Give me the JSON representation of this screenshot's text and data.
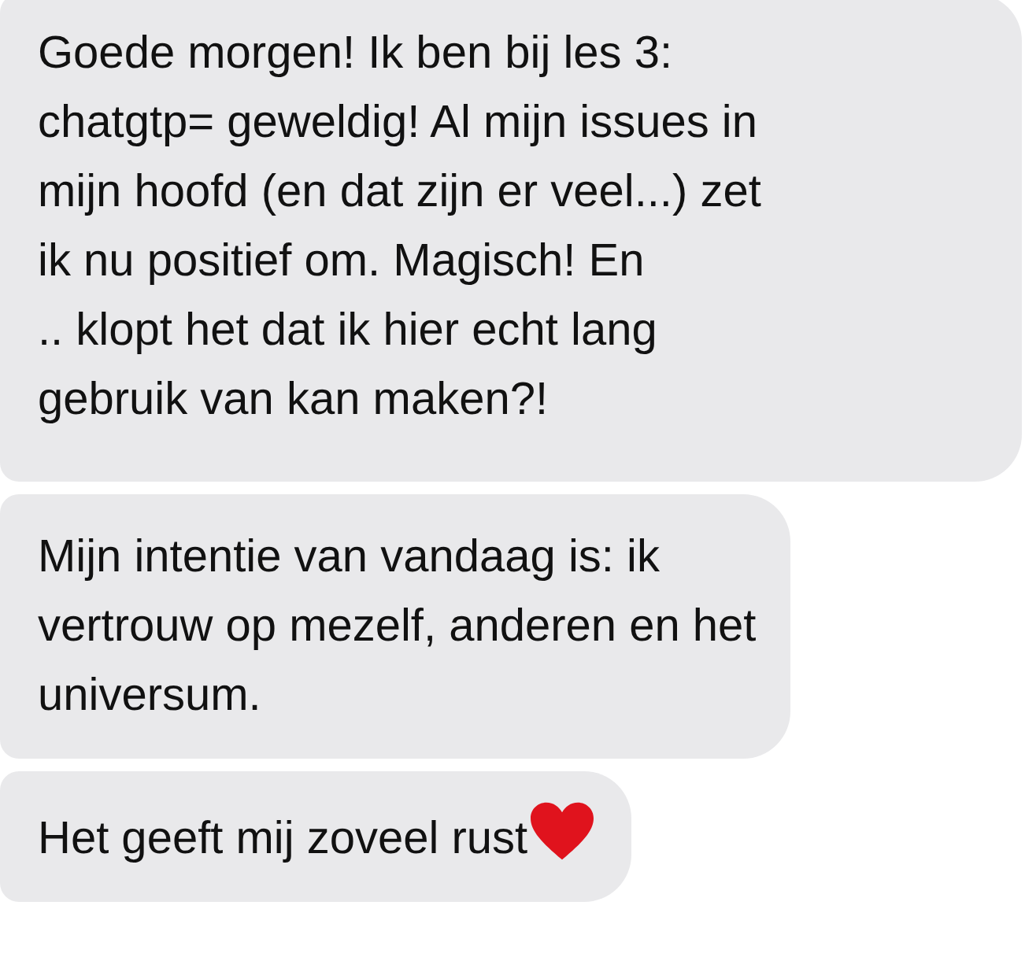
{
  "messages": [
    {
      "text": "Goede morgen! Ik ben bij les 3:\nchatgtp= geweldig! Al mijn issues in\nmijn hoofd (en dat zijn er veel...) zet\nik nu positief om. Magisch! En\n.. klopt het dat ik hier echt lang\ngebruik van kan maken?!",
      "heart": false
    },
    {
      "text": "Mijn intentie van vandaag is: ik\nvertrouw op mezelf, anderen en het\nuniversum.",
      "heart": false
    },
    {
      "text": "Het geeft mij zoveel rust",
      "heart": true
    }
  ]
}
